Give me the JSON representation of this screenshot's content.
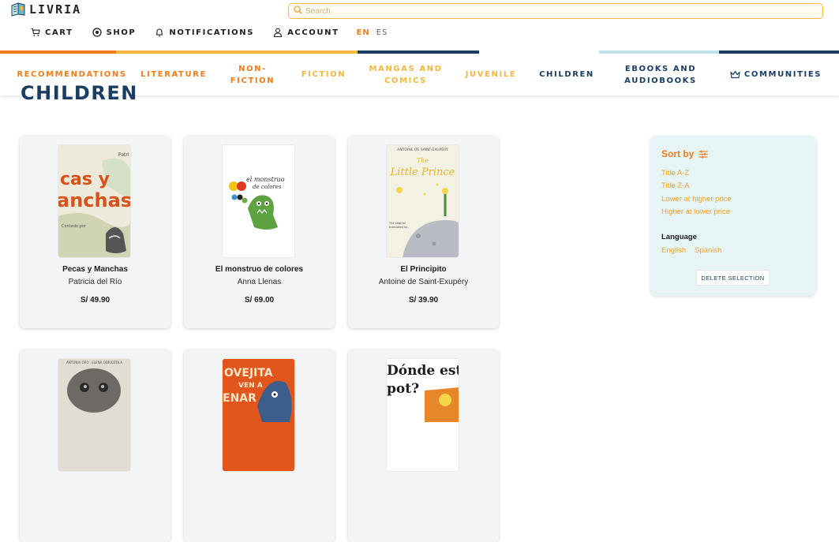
{
  "brand": {
    "name": "LIVRIA"
  },
  "search": {
    "placeholder": "Search",
    "value": ""
  },
  "usernav": {
    "cart": {
      "label": "CART",
      "icon": "cart-icon"
    },
    "shop": {
      "label": "SHOP",
      "icon": "location-pin-icon"
    },
    "notifications": {
      "label": "NOTIFICATIONS",
      "icon": "bell-icon"
    },
    "account": {
      "label": "ACCOUNT",
      "icon": "user-icon"
    },
    "languages": {
      "active": "EN",
      "inactive": "ES"
    }
  },
  "stripe_colors": [
    "#f07c1a",
    "#f4b740",
    "#1a3e63",
    "#bfe3e6",
    "#1a3e63"
  ],
  "categories": [
    {
      "label": "RECOMMENDATIONS",
      "color": "#f07c1a"
    },
    {
      "label": "LITERATURE",
      "color": "#f07c1a"
    },
    {
      "label": "NON-\nFICTION",
      "color": "#f07c1a"
    },
    {
      "label": "FICTION",
      "color": "#f4b740"
    },
    {
      "label": "MANGAS AND\nCOMICS",
      "color": "#f4b740"
    },
    {
      "label": "JUVENILE",
      "color": "#f4b740"
    },
    {
      "label": "CHILDREN",
      "color": "#1a3e63"
    },
    {
      "label": "EBOOKS AND\nAUDIOBOOKS",
      "color": "#1a3e63"
    },
    {
      "label": "COMMUNITIES",
      "color": "#1a3e63",
      "icon": "crown-icon"
    }
  ],
  "page": {
    "title": "CHILDREN"
  },
  "books": [
    {
      "title": "Pecas y Manchas",
      "author": "Patricia del Río",
      "price": "S/ 49.90",
      "cover_text": "Pecas y Manchas"
    },
    {
      "title": "El monstruo de colores",
      "author": "Anna Llenas",
      "price": "S/ 69.00",
      "cover_text": "el monstruo de colores"
    },
    {
      "title": "El Principito",
      "author": "Antoine de Saint-Exupéry",
      "price": "S/ 39.90",
      "cover_text_top": "ANTOINE DE SAINT-EXUPÉRY",
      "cover_text": "The Little Prince"
    },
    {
      "title": "",
      "author": "",
      "price": ""
    },
    {
      "title": "",
      "author": "",
      "price": "",
      "cover_text": "Ovejita ven a cenar"
    },
    {
      "title": "",
      "author": "",
      "price": "",
      "cover_text": "¿Dónde está Spot?"
    }
  ],
  "sort": {
    "heading": "Sort by",
    "options": [
      "Title A-Z",
      "Title Z-A",
      "Lower at higher price",
      "Higher at lower price"
    ],
    "language_heading": "Language",
    "languages": [
      "English",
      "Spanish"
    ],
    "delete_label": "DELETE SELECTION"
  }
}
